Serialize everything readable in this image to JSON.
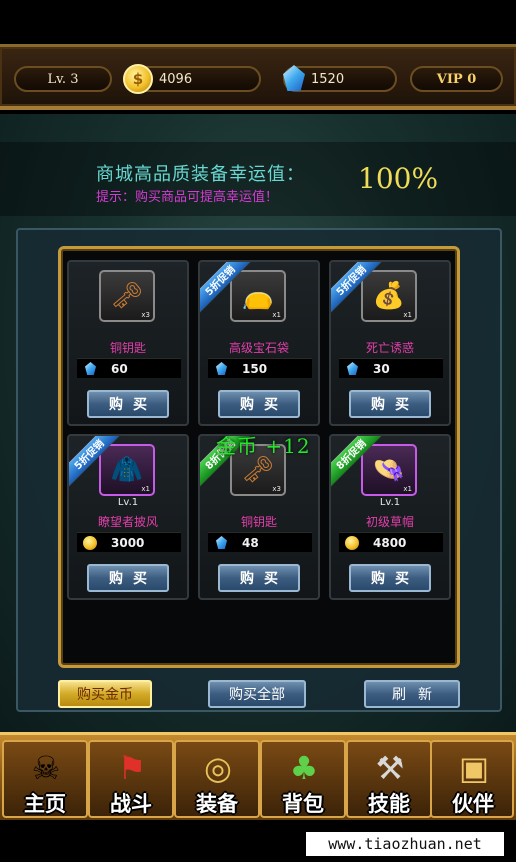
{
  "status": {
    "level": "Lv. 3",
    "gold": "4096",
    "gems": "1520",
    "vip": "VIP 0"
  },
  "luck": {
    "title": "商城高品质装备幸运值：",
    "hint": "提示：购买商品可提高幸运值！",
    "value": "100%"
  },
  "shop_items": [
    {
      "name": "铜钥匙",
      "qty": "x3",
      "level": "",
      "price": "60",
      "currency": "gem",
      "badge": "",
      "buy": "购买"
    },
    {
      "name": "高级宝石袋",
      "qty": "x1",
      "level": "",
      "price": "150",
      "currency": "gem",
      "badge": "5折促销",
      "buy": "购买"
    },
    {
      "name": "死亡诱惑",
      "qty": "x1",
      "level": "",
      "price": "30",
      "currency": "gem",
      "badge": "5折促销",
      "buy": "购买"
    },
    {
      "name": "瞭望者披风",
      "qty": "x1",
      "level": "Lv.1",
      "price": "3000",
      "currency": "gold",
      "badge": "5折促销",
      "buy": "购买"
    },
    {
      "name": "铜钥匙",
      "qty": "x3",
      "level": "",
      "price": "48",
      "currency": "gem",
      "badge": "8折促销",
      "buy": "购买"
    },
    {
      "name": "初级草帽",
      "qty": "x1",
      "level": "Lv.1",
      "price": "4800",
      "currency": "gold",
      "badge": "8折促销",
      "buy": "购买"
    }
  ],
  "float_text": "金币 +12",
  "actions": {
    "buy_gold": "购买金币",
    "buy_all": "购买全部",
    "refresh": "刷新"
  },
  "nav": [
    {
      "label": "主页",
      "icon": "skull-hat-icon"
    },
    {
      "label": "战斗",
      "icon": "pirate-flag-icon"
    },
    {
      "label": "装备",
      "icon": "equipment-ring-icon"
    },
    {
      "label": "背包",
      "icon": "money-bag-icon"
    },
    {
      "label": "技能",
      "icon": "hammer-icon"
    },
    {
      "label": "伙伴",
      "icon": "partner-card-icon"
    }
  ],
  "watermark": "www.tiaozhuan.net",
  "colors": {
    "luck_title": "#67d7d1",
    "hint": "#d63bd3",
    "luck_value": "#f0dc58",
    "item_name": "#e23faa",
    "float_text": "#26e62c",
    "frame_gold": "#c49a3a"
  }
}
